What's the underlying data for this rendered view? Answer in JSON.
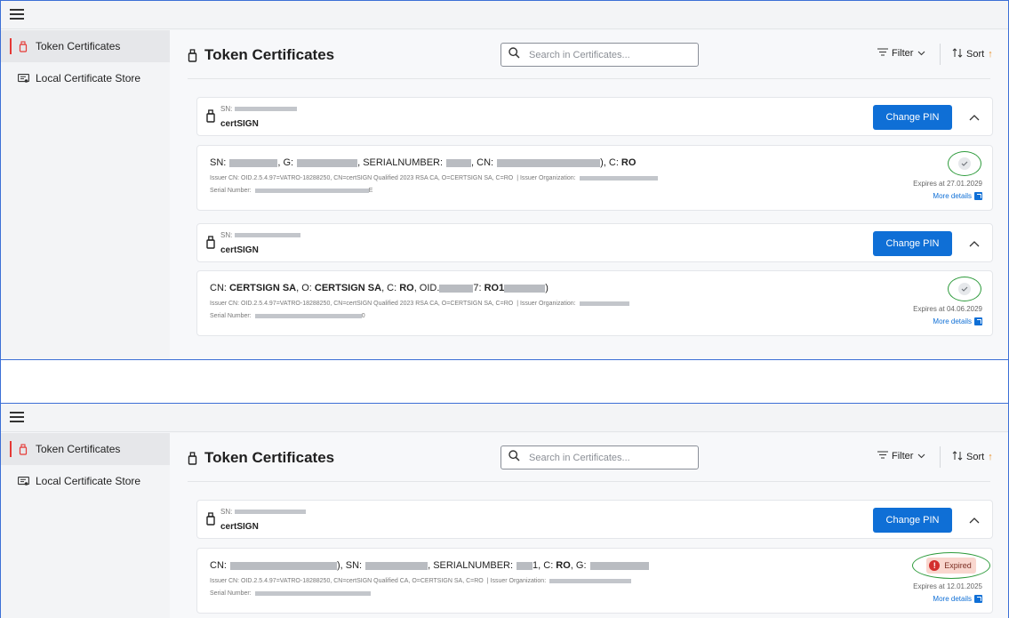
{
  "sidebar": {
    "items": [
      {
        "label": "Token Certificates"
      },
      {
        "label": "Local Certificate Store"
      }
    ]
  },
  "header": {
    "title": "Token Certificates",
    "search_placeholder": "Search in Certificates...",
    "filter_label": "Filter",
    "sort_label": "Sort",
    "sort_arrow": "↑"
  },
  "token_fields": {
    "sn_label": "SN:",
    "change_pin_label": "Change PIN"
  },
  "tokens": [
    {
      "name": "certSIGN"
    },
    {
      "name": "certSIGN"
    },
    {
      "name": "certSIGN"
    }
  ],
  "certificates": [
    {
      "subject": {
        "sn": "SN:",
        "g": ", G:",
        "serialnumber": ", SERIALNUMBER:",
        "cn": ", CN:",
        "c": "), C:",
        "c_value": "RO"
      },
      "issuer_cn": "Issuer CN: OID.2.5.4.97=VATRO-18288250, CN=certSIGN Qualified 2023 RSA CA, O=CERTSIGN SA, C=RO",
      "issuer_org_label": "| Issuer Organization:",
      "serial_label": "Serial Number:",
      "serial_tail": "E",
      "expires": "Expires at 27.01.2029",
      "more_details": "More details"
    },
    {
      "subject": {
        "cn": "CN:",
        "cn_value": "CERTSIGN SA",
        "o": ", O:",
        "o_value": "CERTSIGN SA",
        "c": ", C:",
        "c_value": "RO",
        "oid": ", OID.",
        "oid_tail": "7:",
        "oid_value": "RO1",
        "close": ")"
      },
      "issuer_cn": "Issuer CN: OID.2.5.4.97=VATRO-18288250, CN=certSIGN Qualified 2023 RSA CA, O=CERTSIGN SA, C=RO",
      "issuer_org_label": "| Issuer Organization:",
      "serial_label": "Serial Number:",
      "serial_tail": "0",
      "expires": "Expires at 04.06.2029",
      "more_details": "More details"
    },
    {
      "subject": {
        "cn": "CN:",
        "sn": "), SN:",
        "serialnumber": ", SERIALNUMBER:",
        "c": "1, C:",
        "c_value": "RO",
        "g": ", G:"
      },
      "issuer_cn": "Issuer CN: OID.2.5.4.97=VATRO-18288250, CN=certSIGN Qualified CA, O=CERTSIGN SA, C=RO",
      "issuer_org_label": "| Issuer Organization:",
      "serial_label": "Serial Number:",
      "status": "Expired",
      "expires": "Expires at 12.01.2025",
      "more_details": "More details"
    }
  ],
  "colors": {
    "accent": "#0f6fd6",
    "active_marker": "#e53935",
    "status_ring": "#2e9b3c",
    "expired": "#d32f2f"
  }
}
